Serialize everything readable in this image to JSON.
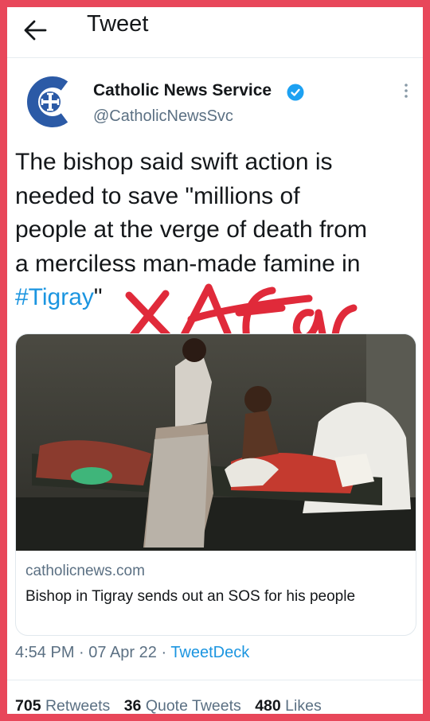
{
  "topbar": {
    "title": "Tweet",
    "back_icon": "arrow-left-icon"
  },
  "author": {
    "name": "Catholic News Service",
    "handle": "@CatholicNewsSvc",
    "verified_icon": "verified-badge-icon",
    "avatar_icon": "cns-logo-icon"
  },
  "tweet": {
    "text": "The bishop said swift action is\nneeded to save \"millions of\npeople at the verge of death from\na merciless man-made famine in\n",
    "hashtag": "#Tigray",
    "text_end": "\"",
    "handwritten_overlay": "X Afar"
  },
  "card": {
    "domain": "catholicnews.com",
    "title": "Bishop in Tigray sends out an SOS for his people",
    "photo_icon": "news-photo"
  },
  "meta": {
    "time": "4:54 PM",
    "date": "07 Apr 22",
    "source": "TweetDeck",
    "sep": " · "
  },
  "stats": {
    "retweets_count": "705",
    "retweets_label": "Retweets",
    "quotes_count": "36",
    "quotes_label": "Quote Tweets",
    "likes_count": "480",
    "likes_label": "Likes"
  },
  "colors": {
    "frame": "#e8475a",
    "link": "#1b95e0",
    "brand": "#2b5aa6",
    "ink": "#e02a3a"
  }
}
